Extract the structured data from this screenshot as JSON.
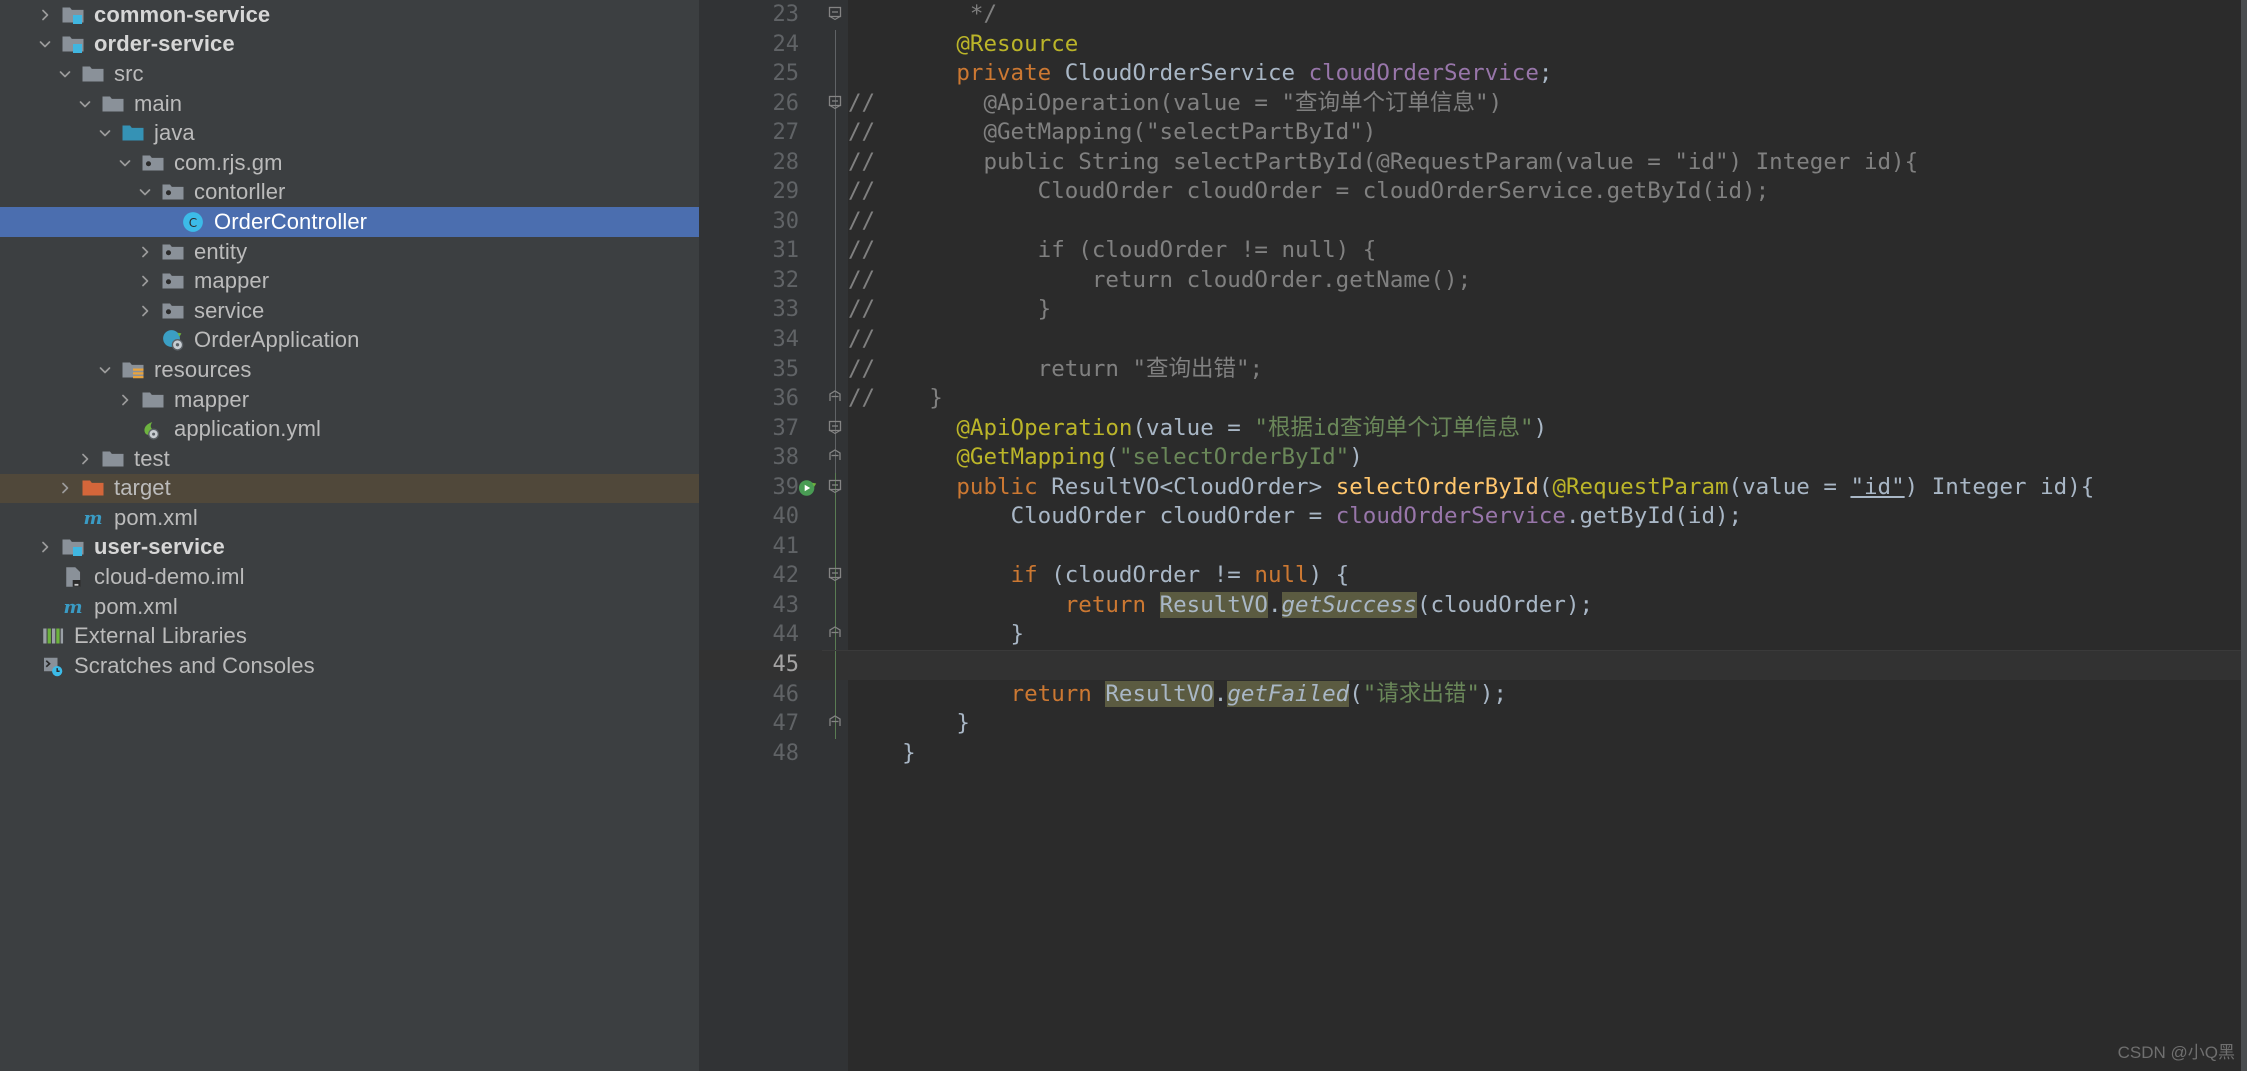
{
  "window": {
    "app": "IntelliJ IDEA",
    "watermark": "CSDN @小Q黑"
  },
  "project_tree": {
    "name": "Project tool window",
    "items": [
      {
        "indent": 0,
        "arrow": "right",
        "icon": "module-folder-icon",
        "label": "common-service",
        "bold": true,
        "state": "collapsed"
      },
      {
        "indent": 0,
        "arrow": "down",
        "icon": "module-folder-icon",
        "label": "order-service",
        "bold": true,
        "state": "expanded"
      },
      {
        "indent": 1,
        "arrow": "down",
        "icon": "folder-icon",
        "label": "src",
        "bold": false,
        "state": "expanded"
      },
      {
        "indent": 2,
        "arrow": "down",
        "icon": "folder-icon",
        "label": "main",
        "bold": false,
        "state": "expanded"
      },
      {
        "indent": 3,
        "arrow": "down",
        "icon": "source-folder-icon",
        "label": "java",
        "bold": false,
        "state": "expanded"
      },
      {
        "indent": 4,
        "arrow": "down",
        "icon": "package-icon",
        "label": "com.rjs.gm",
        "bold": false,
        "state": "expanded"
      },
      {
        "indent": 5,
        "arrow": "down",
        "icon": "package-icon",
        "label": "contorller",
        "bold": false,
        "state": "expanded"
      },
      {
        "indent": 6,
        "arrow": "none",
        "icon": "java-class-icon",
        "label": "OrderController",
        "bold": false,
        "state": "selected"
      },
      {
        "indent": 5,
        "arrow": "right",
        "icon": "package-icon",
        "label": "entity",
        "bold": false,
        "state": "collapsed"
      },
      {
        "indent": 5,
        "arrow": "right",
        "icon": "package-icon",
        "label": "mapper",
        "bold": false,
        "state": "collapsed"
      },
      {
        "indent": 5,
        "arrow": "right",
        "icon": "package-icon",
        "label": "service",
        "bold": false,
        "state": "collapsed"
      },
      {
        "indent": 5,
        "arrow": "none",
        "icon": "spring-boot-icon",
        "label": "OrderApplication",
        "bold": false,
        "state": "normal"
      },
      {
        "indent": 3,
        "arrow": "down",
        "icon": "resources-folder-icon",
        "label": "resources",
        "bold": false,
        "state": "expanded"
      },
      {
        "indent": 4,
        "arrow": "right",
        "icon": "folder-icon",
        "label": "mapper",
        "bold": false,
        "state": "collapsed"
      },
      {
        "indent": 4,
        "arrow": "none",
        "icon": "spring-yaml-icon",
        "label": "application.yml",
        "bold": false,
        "state": "normal"
      },
      {
        "indent": 2,
        "arrow": "right",
        "icon": "folder-icon",
        "label": "test",
        "bold": false,
        "state": "collapsed"
      },
      {
        "indent": 1,
        "arrow": "right",
        "icon": "excluded-folder-icon",
        "label": "target",
        "bold": false,
        "state": "highlighted"
      },
      {
        "indent": 1,
        "arrow": "none",
        "icon": "maven-icon",
        "label": "pom.xml",
        "bold": false,
        "state": "normal"
      },
      {
        "indent": 0,
        "arrow": "right",
        "icon": "module-folder-icon",
        "label": "user-service",
        "bold": true,
        "state": "collapsed"
      },
      {
        "indent": 0,
        "arrow": "none",
        "icon": "iml-file-icon",
        "label": "cloud-demo.iml",
        "bold": false,
        "state": "normal"
      },
      {
        "indent": 0,
        "arrow": "none",
        "icon": "maven-icon",
        "label": "pom.xml",
        "bold": false,
        "state": "normal"
      },
      {
        "indent": -1,
        "arrow": "none",
        "icon": "external-libraries-icon",
        "label": "External Libraries",
        "bold": false,
        "state": "normal"
      },
      {
        "indent": -1,
        "arrow": "none",
        "icon": "scratches-icon",
        "label": "Scratches and Consoles",
        "bold": false,
        "state": "normal"
      }
    ]
  },
  "editor": {
    "name": "OrderController.java editor",
    "first_line": 23,
    "cursor_line": 45,
    "lines": [
      {
        "n": 23,
        "fold": "minus",
        "gutter_line": "none",
        "run": false,
        "cursor": false
      },
      {
        "n": 24,
        "fold": "none",
        "gutter_line": "plain",
        "run": false,
        "cursor": false
      },
      {
        "n": 25,
        "fold": "none",
        "gutter_line": "plain",
        "run": false,
        "cursor": false
      },
      {
        "n": 26,
        "fold": "minus",
        "gutter_line": "plain",
        "run": false,
        "cursor": false
      },
      {
        "n": 27,
        "fold": "none",
        "gutter_line": "plain",
        "run": false,
        "cursor": false
      },
      {
        "n": 28,
        "fold": "none",
        "gutter_line": "plain",
        "run": false,
        "cursor": false
      },
      {
        "n": 29,
        "fold": "none",
        "gutter_line": "plain",
        "run": false,
        "cursor": false
      },
      {
        "n": 30,
        "fold": "none",
        "gutter_line": "plain",
        "run": false,
        "cursor": false
      },
      {
        "n": 31,
        "fold": "none",
        "gutter_line": "plain",
        "run": false,
        "cursor": false
      },
      {
        "n": 32,
        "fold": "none",
        "gutter_line": "plain",
        "run": false,
        "cursor": false
      },
      {
        "n": 33,
        "fold": "none",
        "gutter_line": "plain",
        "run": false,
        "cursor": false
      },
      {
        "n": 34,
        "fold": "none",
        "gutter_line": "plain",
        "run": false,
        "cursor": false
      },
      {
        "n": 35,
        "fold": "none",
        "gutter_line": "plain",
        "run": false,
        "cursor": false
      },
      {
        "n": 36,
        "fold": "end",
        "gutter_line": "plain",
        "run": false,
        "cursor": false
      },
      {
        "n": 37,
        "fold": "minus",
        "gutter_line": "plain",
        "run": false,
        "cursor": false
      },
      {
        "n": 38,
        "fold": "end",
        "gutter_line": "plain",
        "run": false,
        "cursor": false
      },
      {
        "n": 39,
        "fold": "minus",
        "gutter_line": "green",
        "run": true,
        "cursor": false
      },
      {
        "n": 40,
        "fold": "none",
        "gutter_line": "green",
        "run": false,
        "cursor": false
      },
      {
        "n": 41,
        "fold": "none",
        "gutter_line": "green",
        "run": false,
        "cursor": false
      },
      {
        "n": 42,
        "fold": "minus",
        "gutter_line": "green",
        "run": false,
        "cursor": false
      },
      {
        "n": 43,
        "fold": "none",
        "gutter_line": "green",
        "run": false,
        "cursor": false
      },
      {
        "n": 44,
        "fold": "end",
        "gutter_line": "green",
        "run": false,
        "cursor": false
      },
      {
        "n": 45,
        "fold": "none",
        "gutter_line": "green",
        "run": false,
        "cursor": true
      },
      {
        "n": 46,
        "fold": "none",
        "gutter_line": "green",
        "run": false,
        "cursor": false
      },
      {
        "n": 47,
        "fold": "end",
        "gutter_line": "green",
        "run": false,
        "cursor": false
      },
      {
        "n": 48,
        "fold": "none",
        "gutter_line": "none",
        "run": false,
        "cursor": false
      }
    ],
    "code_text": [
      "         */",
      "        @Resource",
      "        private CloudOrderService cloudOrderService;",
      "//        @ApiOperation(value = \"查询单个订单信息\")",
      "//        @GetMapping(\"selectPartById\")",
      "//        public String selectPartById(@RequestParam(value = \"id\") Integer id){",
      "//            CloudOrder cloudOrder = cloudOrderService.getById(id);",
      "//",
      "//            if (cloudOrder != null) {",
      "//                return cloudOrder.getName();",
      "//            }",
      "//",
      "//            return \"查询出错\";",
      "//    }",
      "        @ApiOperation(value = \"根据id查询单个订单信息\")",
      "        @GetMapping(\"selectOrderById\")",
      "        public ResultVO<CloudOrder> selectOrderById(@RequestParam(value = \"id\") Integer id){",
      "            CloudOrder cloudOrder = cloudOrderService.getById(id);",
      "",
      "            if (cloudOrder != null) {",
      "                return ResultVO.getSuccess(cloudOrder);",
      "            }",
      "",
      "            return ResultVO.getFailed(\"请求出错\");",
      "        }",
      "    }"
    ],
    "strings": {
      "api_operation_1": "查询单个订单信息",
      "get_mapping_1": "selectPartById",
      "query_error": "查询出错",
      "api_operation_2": "根据id查询单个订单信息",
      "get_mapping_2": "selectOrderById",
      "request_error": "请求出错",
      "param_id": "id"
    }
  }
}
